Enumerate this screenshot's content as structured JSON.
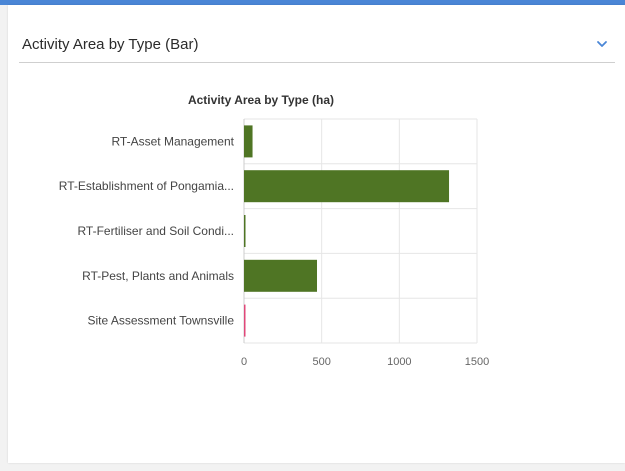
{
  "panel": {
    "title": "Activity Area by Type (Bar)",
    "accent_color": "#4a86d6",
    "collapse_icon": "chevron-down-icon"
  },
  "chart_data": {
    "type": "bar",
    "orientation": "horizontal",
    "title": "Activity Area by Type (ha)",
    "categories": [
      "RT-Asset Management",
      "RT-Establishment of Pongamia...",
      "RT-Fertiliser and Soil Condi...",
      "RT-Pest, Plants and Animals",
      "Site Assessment Townsville"
    ],
    "values": [
      55,
      1320,
      5,
      470,
      3
    ],
    "colors": [
      "#4f7524",
      "#4f7524",
      "#4f7524",
      "#4f7524",
      "#e0487a"
    ],
    "xlim": [
      0,
      1500
    ],
    "xticks": [
      0,
      500,
      1000,
      1500
    ],
    "grid": true
  }
}
